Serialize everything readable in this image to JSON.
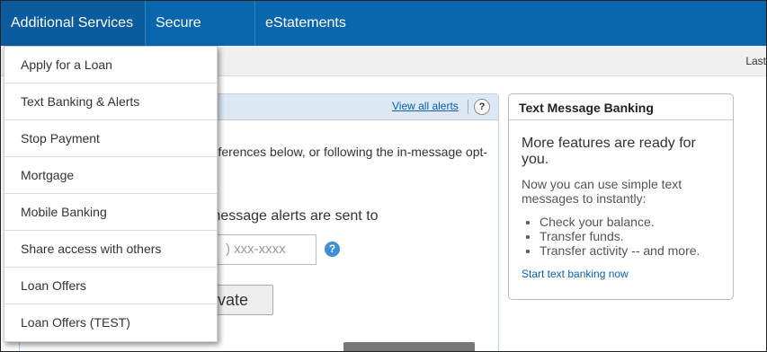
{
  "nav": {
    "tabs": [
      {
        "label": "Additional Services"
      },
      {
        "label": "Secure Forms"
      },
      {
        "label": "eStatements"
      }
    ]
  },
  "subbar": {
    "last_text": "Last"
  },
  "dropdown": {
    "items": [
      {
        "label": "Apply for a Loan"
      },
      {
        "label": "Text Banking & Alerts"
      },
      {
        "label": "Stop Payment"
      },
      {
        "label": "Mortgage"
      },
      {
        "label": "Mobile Banking"
      },
      {
        "label": "Share access with others"
      },
      {
        "label": "Loan Offers"
      },
      {
        "label": "Loan Offers (TEST)"
      }
    ]
  },
  "alerts": {
    "view_all": "View all alerts",
    "help": "?",
    "preferences_text": "references below, or following the in-message opt-",
    "message_text": "message alerts are sent to",
    "phone_placeholder": ") xxx-xxxx",
    "phone_help": "?",
    "activate_label": "tivate"
  },
  "text_banking": {
    "title": "Text Message Banking",
    "lead": "More features are ready for you.",
    "body": "Now you can use simple text messages to instantly:",
    "bullets": [
      {
        "text": "Check your balance."
      },
      {
        "text": "Transfer funds."
      },
      {
        "text": "Transfer activity -- and more."
      }
    ],
    "start_link": "Start text banking now"
  }
}
